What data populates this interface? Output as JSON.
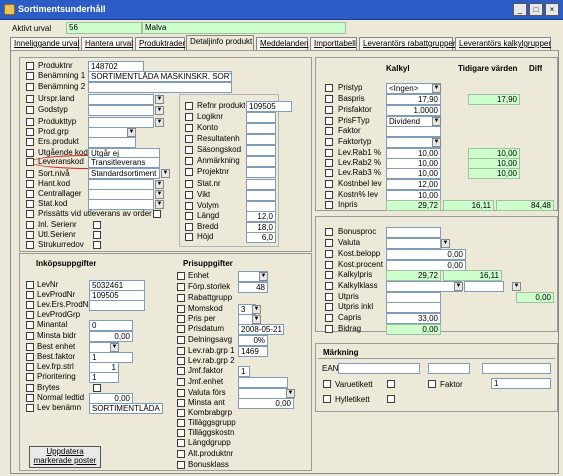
{
  "window": {
    "title": "Sortimentsunderhåll",
    "controls": [
      "_",
      "□",
      "×"
    ]
  },
  "header": {
    "aktivt_urval_label": "Aktivt urval",
    "aktivt_urval_num": "56",
    "aktivt_urval_name": "Malva"
  },
  "tabs": [
    "Inneliggande urval",
    "Hantera urval",
    "Produktrader",
    "Detaljinfo produkt",
    "Meddelanden",
    "Importtabell",
    "Leverantörs rabattgrupper",
    "Leverantörs kalkylgrupper"
  ],
  "product": {
    "labels": [
      "Produktnr",
      "Benämning 1",
      "Benämning 2",
      "Urspr.land",
      "Godstyp",
      "Produkttyp",
      "Prod.grp",
      "Ers.produkt",
      "Utgående kod",
      "Leveranskod",
      "Sort.nivå",
      "Hant.kod",
      "Centrallager",
      "Stat.kod",
      "Prissätts vid utleverans av order",
      "Inl. Serienr",
      "Utl.Serienr",
      "Strukurredov"
    ],
    "produktnr": "148702",
    "benamning1": "SORTIMENTLÅDA MASKINSKR. SORT",
    "utgaende_kod": "Utgår ej",
    "leveranskod": "Transitleverans",
    "sort_niva": "Standardsortiment"
  },
  "mid": {
    "labels": [
      "Refnr produkt",
      "Logiknr",
      "Konto",
      "Resultatenh",
      "Säsongskod",
      "Anmärkning",
      "Projektnr",
      "Stat.nr",
      "Vikt",
      "Volym",
      "Längd",
      "Bredd",
      "Höjd"
    ],
    "refnr": "109505",
    "langd": "12,0",
    "bredd": "18,0",
    "hojd": "6,0"
  },
  "calc": {
    "col_kalkyl": "Kalkyl",
    "col_tidigare": "Tidigare värden",
    "col_diff": "Diff",
    "labels": [
      "Pristyp",
      "Baspris",
      "Prisfaktor",
      "PrisFTyp",
      "Faktor",
      "Faktortyp",
      "Lev.Rab1 %",
      "Lev.Rab2 %",
      "Lev.Rab3 %",
      "Kostnbel lev",
      "Kostn% lev",
      "Inpris"
    ],
    "pristyp": "<Ingen>",
    "baspris": "17,90",
    "baspris_prev": "17,90",
    "prisfaktor": "1,0000",
    "prisftyp": "Dividend",
    "levrab1": "10,00",
    "levrab1_prev": "10,00",
    "levrab2": "10,00",
    "levrab2_prev": "10,00",
    "levrab3": "10,00",
    "levrab3_prev": "10,00",
    "kostnbel": "12,00",
    "kostnpct": "10,00",
    "inpris": "29,72",
    "inpris_prev": "16,11",
    "inpris_diff": "84,48"
  },
  "bonus": {
    "labels": [
      "Bonusproc",
      "Valuta",
      "Kost.belopp",
      "Kost.procent",
      "Kalkylpris",
      "Kalkylklass",
      "Utpris",
      "Utpris inkl",
      "Capris",
      "Bidrag"
    ],
    "kostbelopp": "0,00",
    "kostprocent": "0,00",
    "kalkylpris": "29,72",
    "kalkylpris_prev": "16,11",
    "utpris_diff": "0,00",
    "capris": "33,00",
    "bidrag": "0,00"
  },
  "purchase": {
    "title": "Inköpsuppgifter",
    "labels": [
      "LevNr",
      "LevProdNr",
      "Lev.Ers.ProdNr",
      "LevProdGrp",
      "Minantal",
      "Minsta bidr",
      "Best enhet",
      "Best.faktor",
      "Lev.frp.strl",
      "Prioritering",
      "Brytes",
      "Normal ledtid",
      "Lev benämn"
    ],
    "levnr": "5032461",
    "levprodnr": "109505",
    "minantal": "0",
    "minsta_bidr": "0,00",
    "best_faktor": "1",
    "lev_frp": "1",
    "prioritering": "1",
    "ledtid": "0,00",
    "lev_benamn": "SORTIMENTLÅDA MA"
  },
  "prices": {
    "title": "Prisuppgifter",
    "labels": [
      "Enhet",
      "Förp.storlek",
      "Rabattgrupp",
      "Momskod",
      "Pris per",
      "Prisdatum",
      "Delningsavg",
      "Lev.rab.grp 1",
      "Lev.rab.grp 2",
      "Jmf.faktor",
      "Jmf.enhet",
      "Valuta förs",
      "Minsta ant",
      "Kombrabgrp",
      "Tilläggsgrupp",
      "Tilläggskostn",
      "Längdgrupp",
      "Alt.produktnr",
      "Bonusklass"
    ],
    "forp": "48",
    "momskod": "3",
    "prisdatum": "2008-05-21",
    "delning": "0%",
    "levrab1": "1469",
    "jmf": "1",
    "minsta_ant": "0,00"
  },
  "marking": {
    "title": "Märkning",
    "ean": "EAN",
    "varuetikett": "Varuetikett",
    "faktor": "Faktor",
    "faktor_val": "1",
    "hylletikett": "Hylletikett"
  },
  "update_button": "Uppdatera markerade poster"
}
